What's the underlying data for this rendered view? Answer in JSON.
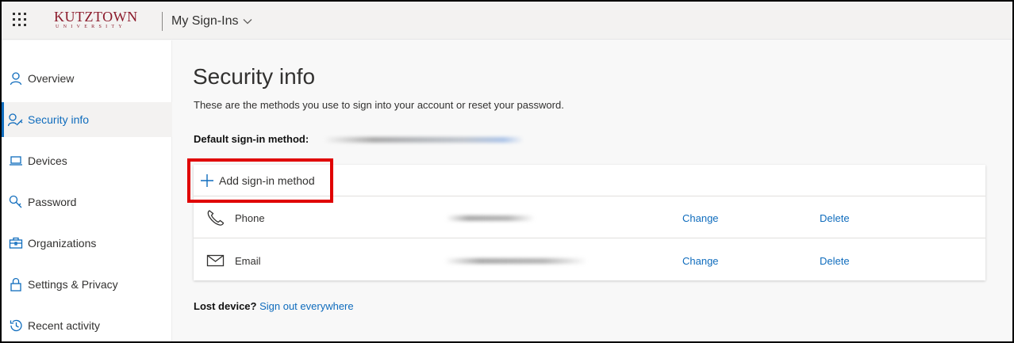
{
  "header": {
    "logo_text": "KUTZTOWN",
    "logo_subtext": "UNIVERSITY",
    "app_name": "My Sign-Ins"
  },
  "sidebar": {
    "items": [
      {
        "label": "Overview",
        "icon": "person-icon"
      },
      {
        "label": "Security info",
        "icon": "person-key-icon",
        "active": true
      },
      {
        "label": "Devices",
        "icon": "laptop-icon"
      },
      {
        "label": "Password",
        "icon": "key-icon"
      },
      {
        "label": "Organizations",
        "icon": "briefcase-icon"
      },
      {
        "label": "Settings & Privacy",
        "icon": "lock-icon"
      },
      {
        "label": "Recent activity",
        "icon": "history-icon"
      }
    ]
  },
  "main": {
    "title": "Security info",
    "description": "These are the methods you use to sign into your account or reset your password.",
    "default_method_label": "Default sign-in method:",
    "add_method_label": "Add sign-in method",
    "methods": [
      {
        "label": "Phone",
        "icon": "phone-icon",
        "change_label": "Change",
        "delete_label": "Delete"
      },
      {
        "label": "Email",
        "icon": "envelope-icon",
        "change_label": "Change",
        "delete_label": "Delete"
      }
    ],
    "lost_device_label": "Lost device?",
    "sign_out_everywhere_label": "Sign out everywhere"
  },
  "colors": {
    "accent": "#0f6cbd",
    "highlight": "#e00000",
    "brand": "#8b1a2b"
  }
}
